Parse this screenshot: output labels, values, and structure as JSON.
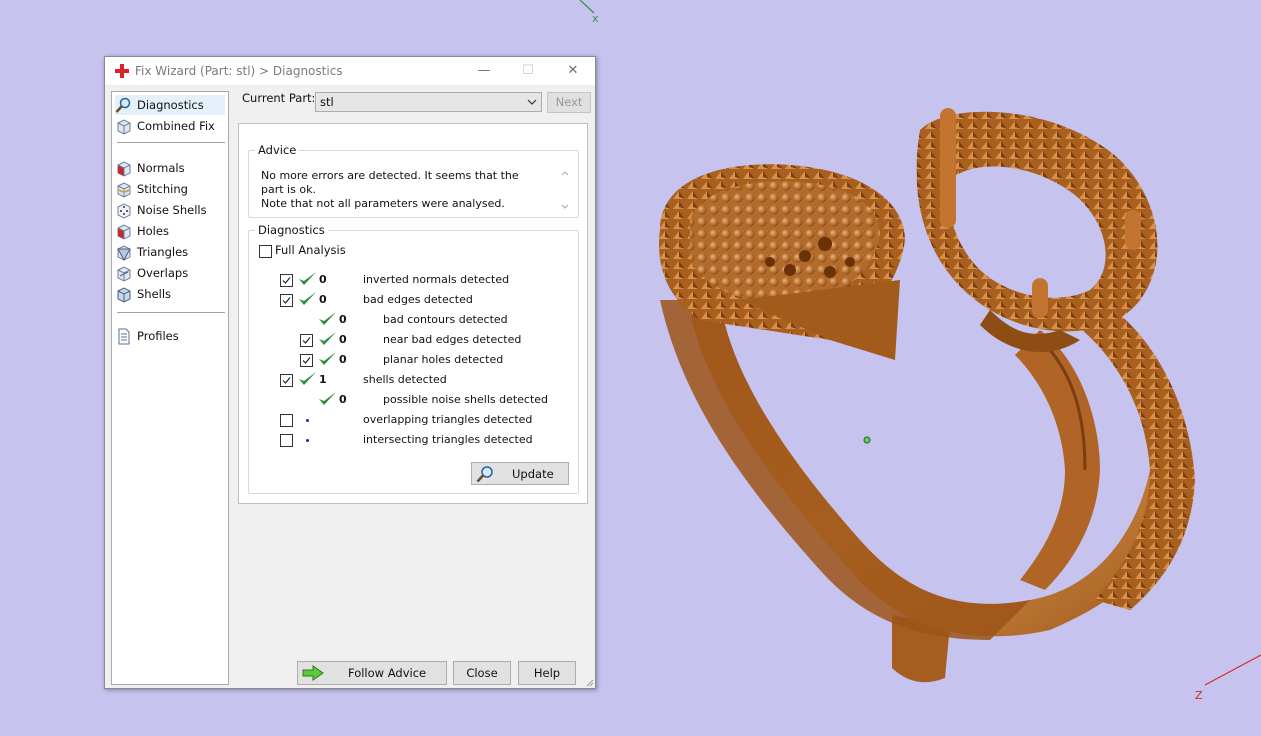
{
  "window": {
    "title": "Fix Wizard (Part: stl) > Diagnostics",
    "minimize": "—",
    "maximize": "☐",
    "close": "✕"
  },
  "nav": {
    "items": [
      {
        "label": "Diagnostics",
        "icon": "magnifier-icon",
        "selected": true
      },
      {
        "label": "Combined Fix",
        "icon": "cube-icon"
      },
      {
        "label": "Normals",
        "icon": "cube-red-face-icon"
      },
      {
        "label": "Stitching",
        "icon": "cube-stitch-icon"
      },
      {
        "label": "Noise Shells",
        "icon": "dice-icon"
      },
      {
        "label": "Holes",
        "icon": "cube-hole-icon"
      },
      {
        "label": "Triangles",
        "icon": "cube-triangle-icon"
      },
      {
        "label": "Overlaps",
        "icon": "cube-overlap-icon"
      },
      {
        "label": "Shells",
        "icon": "cube-shell-icon"
      },
      {
        "label": "Profiles",
        "icon": "document-icon"
      }
    ]
  },
  "current_part": {
    "label": "Current Part:",
    "value": "stl",
    "next": "Next"
  },
  "advice": {
    "title": "Advice",
    "text_line1": "No more errors are detected. It seems that the part is ok.",
    "text_line2": "Note that not all parameters were analysed."
  },
  "diagnostics": {
    "title": "Diagnostics",
    "full_analysis": "Full Analysis",
    "rows": [
      {
        "checked": true,
        "status": "ok",
        "count": "0",
        "label": "inverted normals detected"
      },
      {
        "checked": true,
        "status": "ok",
        "count": "0",
        "label": "bad edges detected"
      },
      {
        "checked": null,
        "status": "ok",
        "count": "0",
        "label": "bad contours detected"
      },
      {
        "checked": true,
        "status": "ok",
        "count": "0",
        "label": "near bad edges detected"
      },
      {
        "checked": true,
        "status": "ok",
        "count": "0",
        "label": "planar holes detected"
      },
      {
        "checked": true,
        "status": "ok",
        "count": "1",
        "label": "shells detected"
      },
      {
        "checked": null,
        "status": "ok",
        "count": "0",
        "label": "possible noise shells detected"
      },
      {
        "checked": false,
        "status": "pending",
        "count": "",
        "label": "overlapping triangles detected"
      },
      {
        "checked": false,
        "status": "pending",
        "count": "",
        "label": "intersecting triangles detected"
      }
    ],
    "update": "Update"
  },
  "buttons": {
    "follow_advice": "Follow Advice",
    "close": "Close",
    "help": "Help"
  },
  "viewport": {
    "background": "#c6c3ef",
    "axis_x": "x",
    "axis_z": "Z"
  },
  "colors": {
    "ring_gold": "#c77a34",
    "check_green": "#2e8b3e",
    "pending_dot": "#1a2fa0"
  }
}
